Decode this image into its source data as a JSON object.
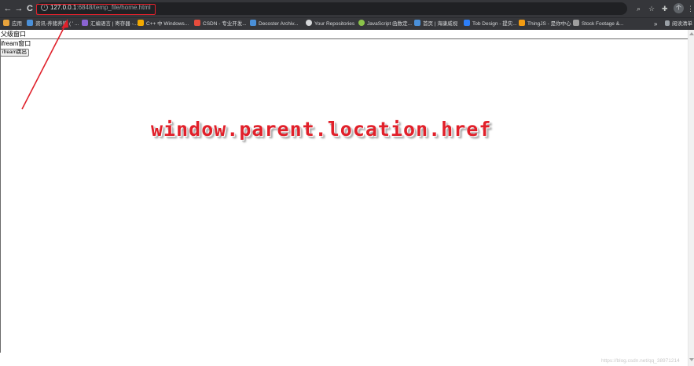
{
  "browser": {
    "url_host": "127.0.0.1",
    "url_rest": ":6848/temp_file/home.html",
    "nav_back": "←",
    "nav_forward": "→",
    "nav_reload": "C",
    "right_icons": [
      "search-icon",
      "star-icon",
      "extension-icon"
    ],
    "avatar_text": "个"
  },
  "bookmarks": {
    "apps_label": "应用",
    "items": [
      {
        "label": "资讯-养猪养猪 ( ' ...",
        "icon": "bookmark-icon",
        "color": "#4a90d9"
      },
      {
        "label": "汇编语言 | 寄存器 -...",
        "icon": "vs-icon",
        "color": "#8a63d2"
      },
      {
        "label": "C++ 中 Windows...",
        "icon": "windows-icon",
        "color": "#f2a900"
      },
      {
        "label": "CSDN - 专业开发...",
        "icon": "csdn-icon",
        "color": "#e74c3c"
      },
      {
        "label": "Decoster Archiv...",
        "icon": "w-icon",
        "color": "#4a90d9"
      },
      {
        "label": "Your Repositories",
        "icon": "github-icon",
        "color": "#d6d8da"
      },
      {
        "label": "JavaScript 函数定...",
        "icon": "js-icon",
        "color": "#8bc34a"
      },
      {
        "label": "首页 | 海康威视",
        "icon": "hik-icon",
        "color": "#4a90d9"
      },
      {
        "label": "Tob Design - 提实...",
        "icon": "b-icon",
        "color": "#2d7ff9"
      },
      {
        "label": "ThingJS - 是你中心",
        "icon": "thingjs-icon",
        "color": "#f39c12"
      },
      {
        "label": "Stock Footage &...",
        "icon": "stock-icon",
        "color": "#9e9e9e"
      }
    ],
    "more_label": "»",
    "reading_list_label": "阅读清单"
  },
  "page": {
    "parent_label": "父级窗口",
    "iframe_label": "ifream窗口",
    "iframe_button": "ifream跳出"
  },
  "annotation": {
    "text": "window.parent.location.href",
    "color": "#e1202a"
  },
  "watermark": "https://blog.csdn.net/qq_38971214"
}
